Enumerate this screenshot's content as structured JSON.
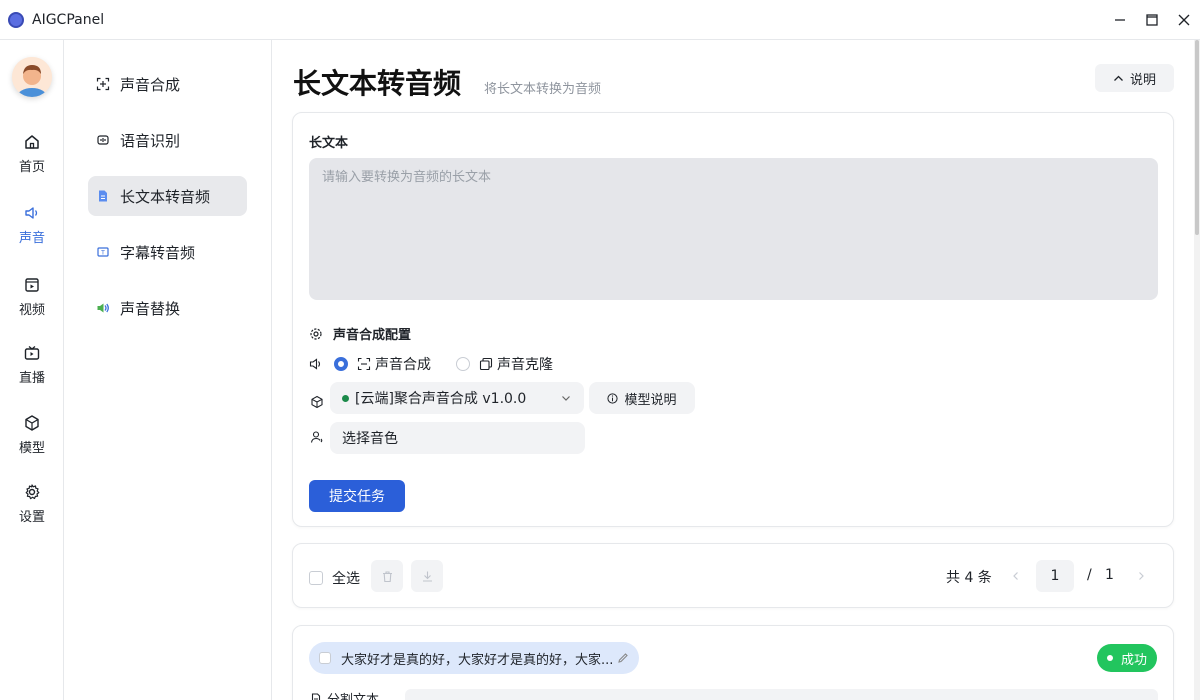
{
  "app": {
    "title": "AIGCPanel"
  },
  "window_controls": [
    "minimize",
    "maximize",
    "close"
  ],
  "rail": {
    "items": [
      {
        "label": "首页",
        "icon": "home-icon"
      },
      {
        "label": "声音",
        "icon": "speaker-icon",
        "active": true
      },
      {
        "label": "视频",
        "icon": "video-icon"
      },
      {
        "label": "直播",
        "icon": "tv-icon"
      },
      {
        "label": "模型",
        "icon": "cube-icon"
      },
      {
        "label": "设置",
        "icon": "gear-icon"
      }
    ]
  },
  "subnav": {
    "items": [
      {
        "label": "声音合成",
        "icon": "scan-icon"
      },
      {
        "label": "语音识别",
        "icon": "voice-recognize-icon"
      },
      {
        "label": "长文本转音频",
        "icon": "document-icon",
        "active": true
      },
      {
        "label": "字幕转音频",
        "icon": "subtitle-icon"
      },
      {
        "label": "声音替换",
        "icon": "speaker-swap-icon"
      }
    ]
  },
  "page": {
    "title": "长文本转音频",
    "subtitle": "将长文本转换为音频",
    "help_label": "说明"
  },
  "form": {
    "text_label": "长文本",
    "text_placeholder": "请输入要转换为音频的长文本",
    "text_value": "",
    "config_label": "声音合成配置",
    "mode_options": [
      {
        "label": "声音合成",
        "checked": true
      },
      {
        "label": "声音克隆",
        "checked": false
      }
    ],
    "model_select": "[云端]聚合声音合成 v1.0.0",
    "model_status_color": "#1c8a4a",
    "model_info_label": "模型说明",
    "voice_select": "选择音色",
    "submit_label": "提交任务"
  },
  "list": {
    "select_all_label": "全选",
    "total_text": "共 4 条",
    "page_current": "1",
    "page_separator": "/",
    "page_total": "1"
  },
  "task": {
    "text_preview": "大家好才是真的好，大家好才是真的好，大家...",
    "status_label": "成功",
    "status_color": "#22c55e",
    "split_label": "分割文本"
  },
  "colors": {
    "accent": "#2b5fd9",
    "active_nav": "#3a6fdb",
    "success": "#22c55e"
  }
}
